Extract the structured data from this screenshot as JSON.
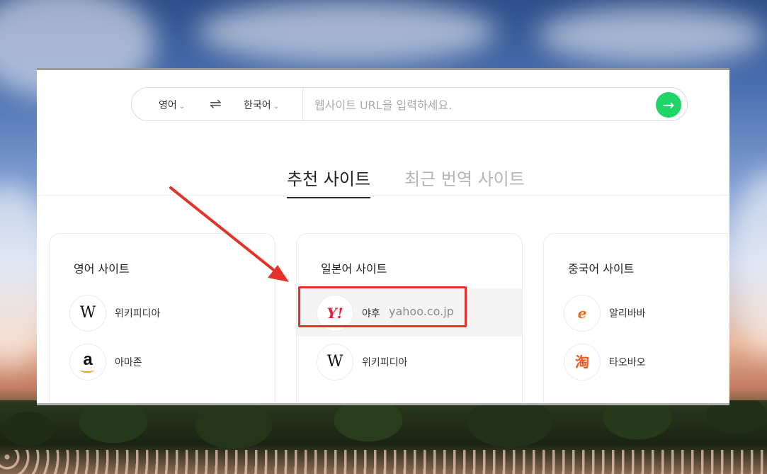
{
  "search": {
    "source_lang": "영어",
    "target_lang": "한국어",
    "url_placeholder": "웹사이트 URL을 입력하세요.",
    "swap_symbol": "⇌",
    "go_symbol": "→",
    "chevron": "⌄"
  },
  "tabs": [
    {
      "label": "추천 사이트",
      "active": true
    },
    {
      "label": "최근 번역 사이트",
      "active": false
    }
  ],
  "cards": [
    {
      "title": "영어 사이트",
      "sites": [
        {
          "name": "위키피디아",
          "logo": "wikipedia-icon",
          "glyph": "W"
        },
        {
          "name": "아마존",
          "logo": "amazon-icon",
          "glyph": "a"
        }
      ]
    },
    {
      "title": "일본어 사이트",
      "sites": [
        {
          "name": "야후",
          "url": "yahoo.co.jp",
          "logo": "yahoo-icon",
          "glyph": "Y!",
          "highlighted": true
        },
        {
          "name": "위키피디아",
          "logo": "wikipedia-icon",
          "glyph": "W"
        }
      ]
    },
    {
      "title": "중국어 사이트",
      "sites": [
        {
          "name": "알리바바",
          "logo": "alibaba-icon",
          "glyph": "e"
        },
        {
          "name": "타오바오",
          "logo": "taobao-icon",
          "glyph": "淘"
        }
      ]
    }
  ],
  "colors": {
    "accent_green": "#1fd468",
    "annotation_red": "#e4322b",
    "yahoo_red": "#e8193c"
  }
}
